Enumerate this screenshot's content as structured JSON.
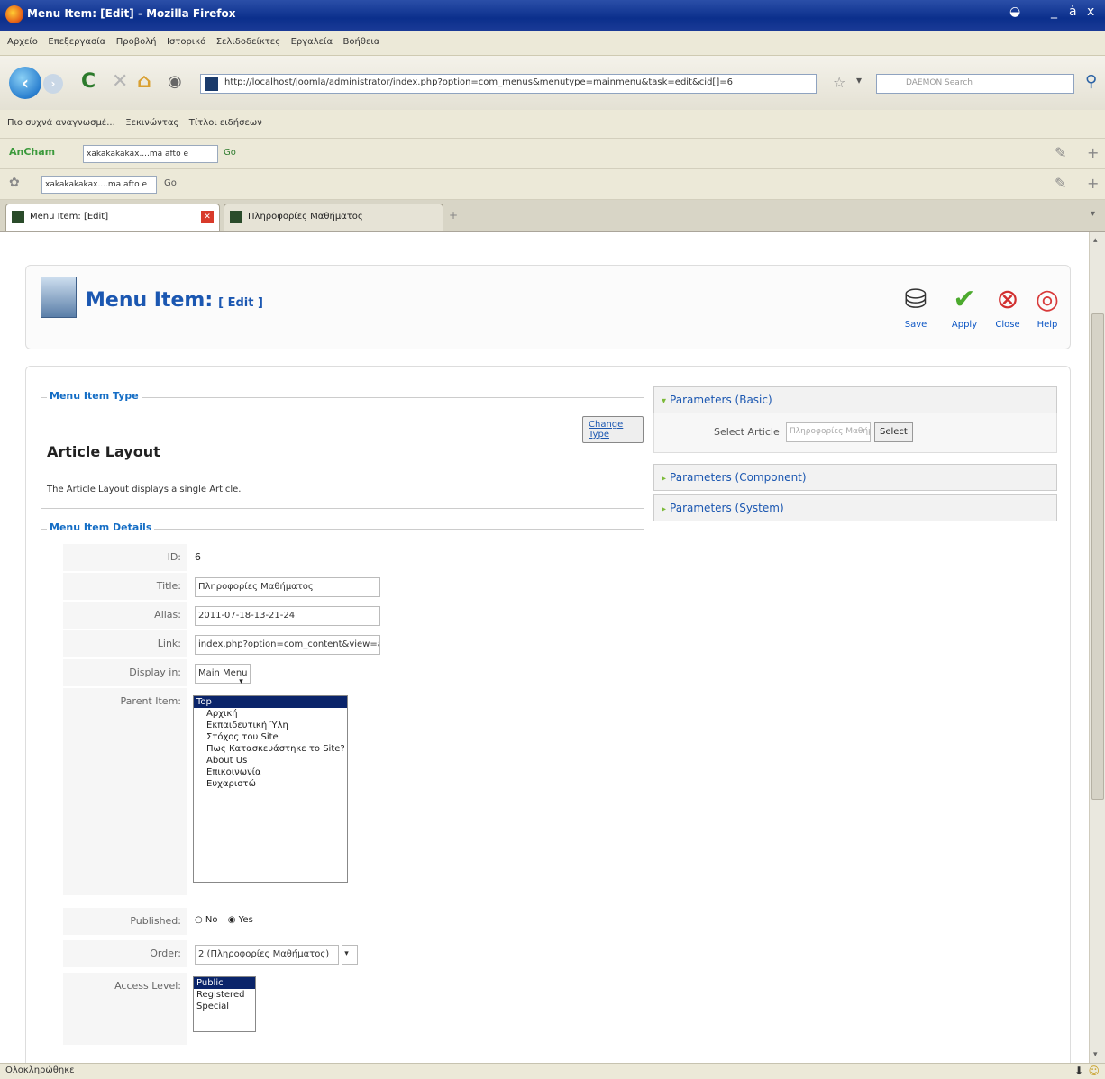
{
  "window": {
    "title": "Menu Item: [Edit] - Mozilla Firefox",
    "controls": [
      "_",
      "ȧ",
      "x"
    ]
  },
  "menubar": [
    "Αρχείο",
    "Επεξεργασία",
    "Προβολή",
    "Ιστορικό",
    "Σελιδοδείκτες",
    "Εργαλεία",
    "Βοήθεια"
  ],
  "navigation": {
    "url": "http://localhost/joomla/administrator/index.php?option=com_menus&menutype=mainmenu&task=edit&cid[]=6",
    "search_placeholder": "DAEMON Search"
  },
  "bookmarks": [
    "Πιο συχνά αναγνωσμέ...",
    "Ξεκινώντας",
    "Τίτλοι ειδήσεων"
  ],
  "toolbar_rows": [
    {
      "field": "xakakakakax....ma afto e",
      "go": "Go"
    },
    {
      "field": "xakakakakax....ma afto e",
      "go": "Go"
    }
  ],
  "tabs": [
    {
      "label": "Menu Item: [Edit]",
      "active": true
    },
    {
      "label": "Πληροφορίες Μαθήματος",
      "active": false
    }
  ],
  "page": {
    "title": "Menu Item:",
    "title_suffix": "[ Edit ]",
    "buttons": [
      {
        "label": "Save",
        "icon": "save-icon"
      },
      {
        "label": "Apply",
        "icon": "apply-icon"
      },
      {
        "label": "Close",
        "icon": "close-icon"
      },
      {
        "label": "Help",
        "icon": "help-icon"
      }
    ]
  },
  "menu_item_type": {
    "legend": "Menu Item Type",
    "change_type_label": "Change Type",
    "layout_title": "Article Layout",
    "layout_description": "The Article Layout displays a single Article."
  },
  "details": {
    "legend": "Menu Item Details",
    "id_label": "ID:",
    "id_value": "6",
    "title_label": "Title:",
    "title_value": "Πληροφορίες Μαθήματος",
    "alias_label": "Alias:",
    "alias_value": "2011-07-18-13-21-24",
    "link_label": "Link:",
    "link_value": "index.php?option=com_content&view=article&",
    "display_label": "Display in:",
    "display_value": "Main Menu",
    "parent_label": "Parent Item:",
    "parent_options": [
      "Top",
      "Αρχική",
      "Εκπαιδευτική Ύλη",
      "Στόχος του Site",
      "Πως Κατασκευάστηκε το Site?",
      "About Us",
      "Επικοινωνία",
      "Ευχαριστώ"
    ],
    "published_label": "Published:",
    "published_no": "No",
    "published_yes": "Yes",
    "order_label": "Order:",
    "order_value": "2 (Πληροφορίες Μαθήματος)",
    "access_label": "Access Level:",
    "access_options": [
      "Public",
      "Registered",
      "Special"
    ]
  },
  "parameters": {
    "basic": "Parameters (Basic)",
    "select_article_label": "Select Article",
    "select_article_value": "Πληροφορίες Μαθήμ",
    "select_button": "Select",
    "component": "Parameters (Component)",
    "system": "Parameters (System)"
  },
  "status": "Ολοκληρώθηκε",
  "colors": {
    "accent": "#1b57b1",
    "legend": "#146dc5",
    "titlebar": "#0b2f8c"
  }
}
